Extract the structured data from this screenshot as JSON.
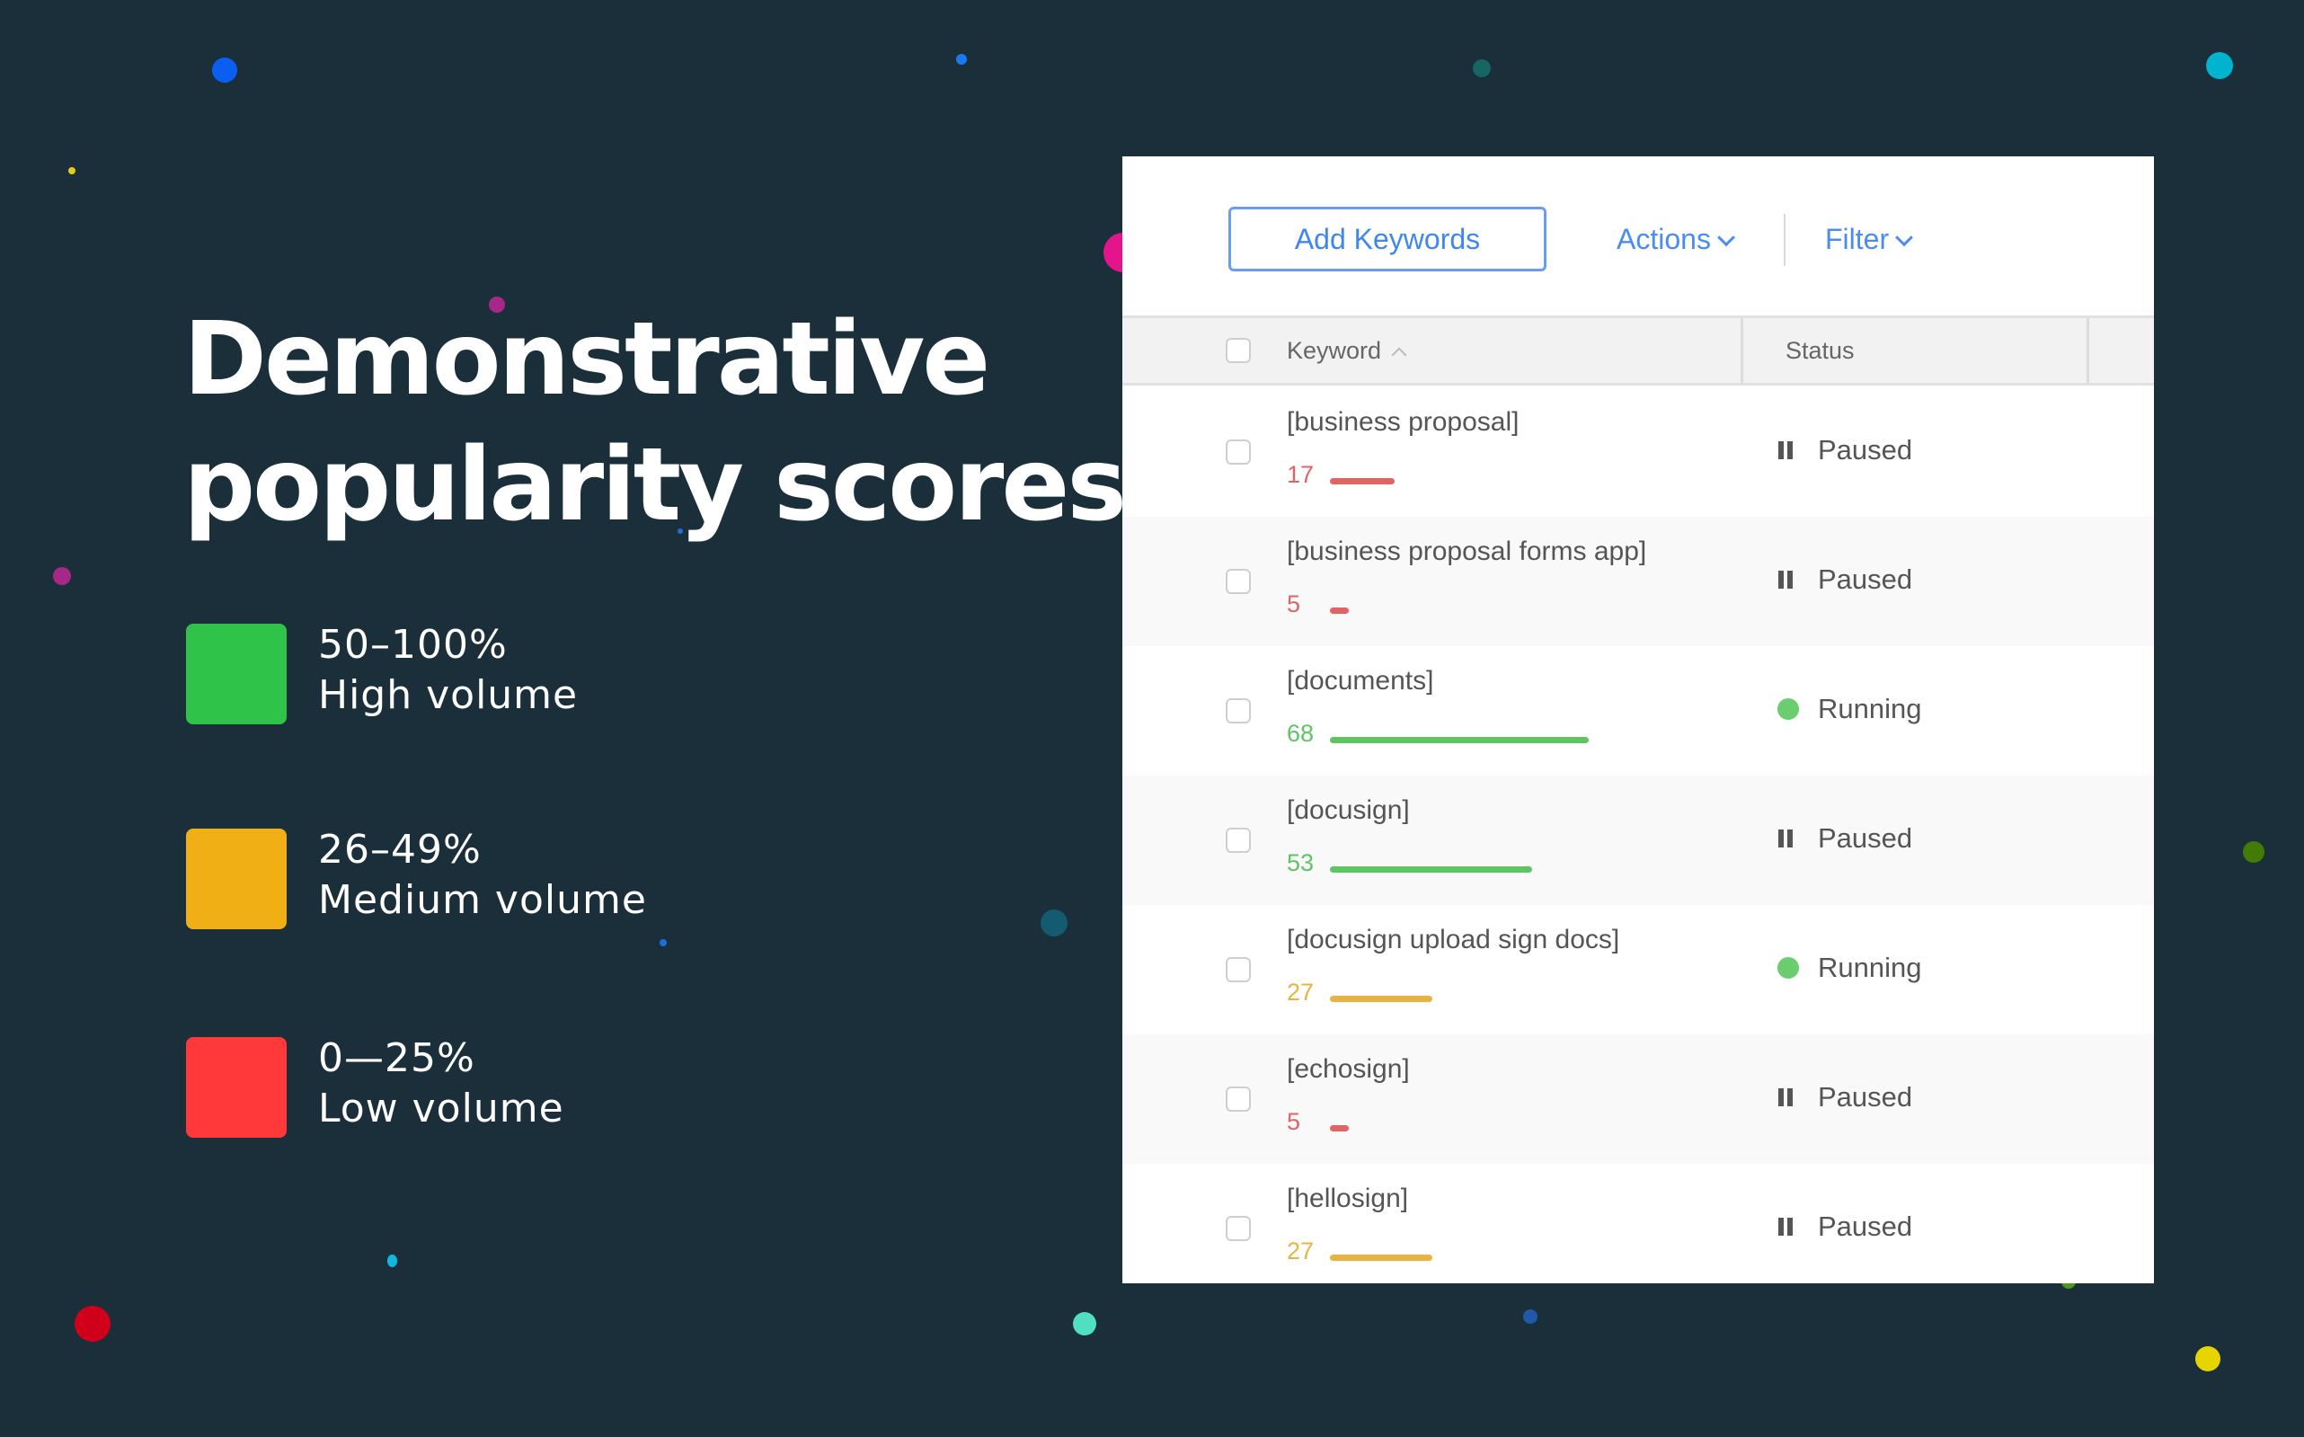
{
  "headline": {
    "line1": "Demonstrative",
    "line2": "popularity scores"
  },
  "legend": [
    {
      "range": "50–100%",
      "label": "High volume",
      "color": "#2fc449"
    },
    {
      "range": "26–49%",
      "label": "Medium volume",
      "color": "#f0b015"
    },
    {
      "range": "0—25%",
      "label": "Low volume",
      "color": "#ff3939"
    }
  ],
  "toolbar": {
    "add_keywords_label": "Add Keywords",
    "actions_label": "Actions",
    "filter_label": "Filter"
  },
  "table": {
    "columns": {
      "keyword": "Keyword",
      "status": "Status"
    },
    "score_colors": {
      "high": "#5dc563",
      "medium": "#e8b343",
      "low": "#e06464"
    },
    "rows": [
      {
        "keyword": "[business proposal]",
        "score": 17,
        "status": "Paused"
      },
      {
        "keyword": "[business proposal forms app]",
        "score": 5,
        "status": "Paused"
      },
      {
        "keyword": "[documents]",
        "score": 68,
        "status": "Running"
      },
      {
        "keyword": "[docusign]",
        "score": 53,
        "status": "Paused"
      },
      {
        "keyword": "[docusign upload sign docs]",
        "score": 27,
        "status": "Running"
      },
      {
        "keyword": "[echosign]",
        "score": 5,
        "status": "Paused"
      },
      {
        "keyword": "[hellosign]",
        "score": 27,
        "status": "Paused"
      }
    ]
  },
  "decorations": {
    "dot_colors": [
      "#0a5ff0",
      "#1a7af0",
      "#e0d010",
      "#176565",
      "#00b4d0",
      "#a8288a",
      "#e3148c",
      "#1a6fe0",
      "#145a70",
      "#10b8e0",
      "#d0001a",
      "#50e0c0",
      "#1e5aa8",
      "#e8d400",
      "#447a06",
      "#4a9a20",
      "#1a5fb0"
    ]
  }
}
